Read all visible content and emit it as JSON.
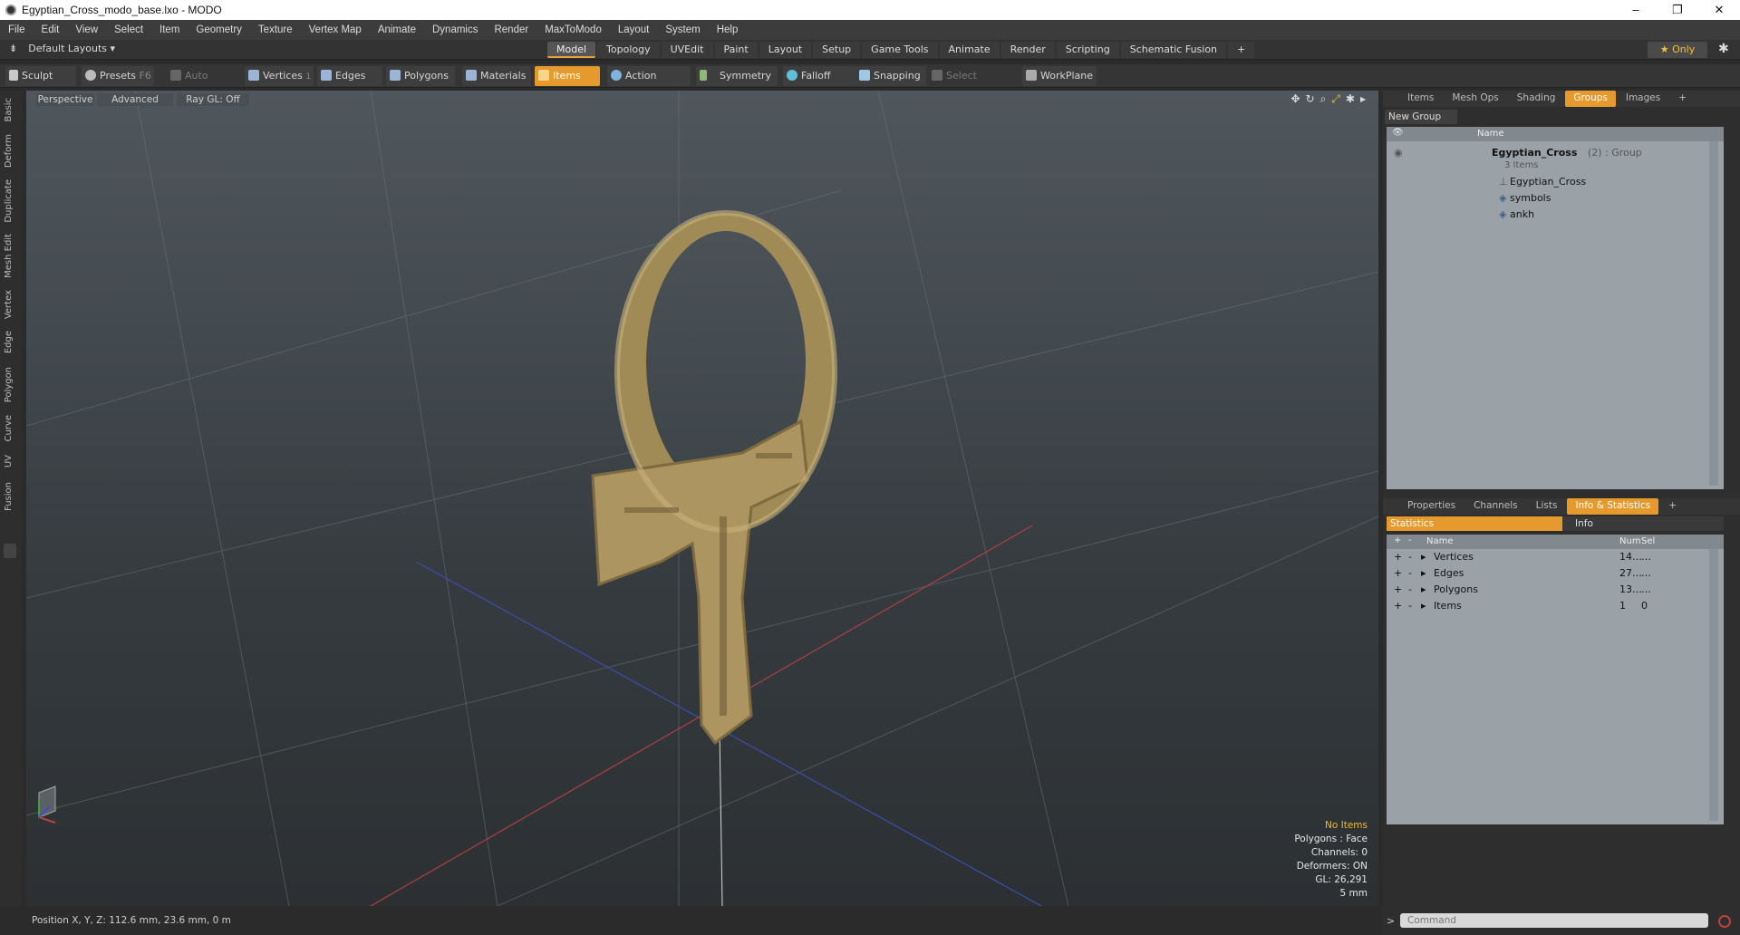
{
  "window": {
    "title": "Egyptian_Cross_modo_base.lxo - MODO",
    "minimize": "–",
    "maximize": "❐",
    "close": "✕"
  },
  "menu": [
    "File",
    "Edit",
    "View",
    "Select",
    "Item",
    "Geometry",
    "Texture",
    "Vertex Map",
    "Animate",
    "Dynamics",
    "Render",
    "MaxToModo",
    "Layout",
    "System",
    "Help"
  ],
  "layouts_label": "Default Layouts ▾",
  "mode_tabs": [
    "Model",
    "Topology",
    "UVEdit",
    "Paint",
    "Layout",
    "Setup",
    "Game Tools",
    "Animate",
    "Render",
    "Scripting",
    "Schematic Fusion",
    "+"
  ],
  "active_mode": "Model",
  "only_label": "★ Only",
  "toolbar": {
    "sculpt": "Sculpt",
    "presets": "Presets",
    "presets_key": "F6",
    "auto_select": "Auto Select",
    "vertices": "Vertices",
    "vertices_num": "1",
    "edges": "Edges",
    "edges_num": "2",
    "polygons": "Polygons",
    "materials": "Materials",
    "items": "Items",
    "action_center": "Action Center",
    "symmetry": "Symmetry",
    "falloff": "Falloff",
    "snapping": "Snapping",
    "select_through": "Select Through",
    "workplane": "WorkPlane"
  },
  "left_tabs": [
    "Basic",
    "Deform",
    "Duplicate",
    "Mesh Edit",
    "Vertex",
    "Edge",
    "Polygon",
    "Curve",
    "UV",
    "Fusion"
  ],
  "viewport": {
    "view": "Perspective",
    "shading": "Advanced",
    "raygl": "Ray GL: Off",
    "info": {
      "items": "No Items",
      "polygons": "Polygons : Face",
      "channels": "Channels: 0",
      "deformers": "Deformers: ON",
      "gl": "GL: 26,291",
      "scale": "5 mm"
    }
  },
  "status": {
    "position": "Position X, Y, Z:   112.6 mm, 23.6 mm, 0 m"
  },
  "groups_panel": {
    "tabs": [
      "Items",
      "Mesh Ops",
      "Shading",
      "Groups",
      "Images",
      "+"
    ],
    "active": "Groups",
    "new_group": "New Group",
    "col_name": "Name",
    "group_name": "Egyptian_Cross",
    "group_suffix": "(2) : Group",
    "group_count": "3 Items",
    "children": [
      "Egyptian_Cross",
      "symbols",
      "ankh"
    ]
  },
  "stats_panel": {
    "tabs": [
      "Properties",
      "Channels",
      "Lists",
      "Info & Statistics",
      "+"
    ],
    "active": "Info & Statistics",
    "sub_statistics": "Statistics",
    "sub_info": "Info",
    "col_name": "Name",
    "col_num": "Num",
    "col_sel": "Sel",
    "rows": [
      {
        "name": "Vertices",
        "num": "14…",
        "sel": "…"
      },
      {
        "name": "Edges",
        "num": "27…",
        "sel": "…"
      },
      {
        "name": "Polygons",
        "num": "13…",
        "sel": "…"
      },
      {
        "name": "Items",
        "num": "1",
        "sel": "0"
      }
    ]
  },
  "command": {
    "placeholder": "Command",
    "prompt": ">"
  }
}
